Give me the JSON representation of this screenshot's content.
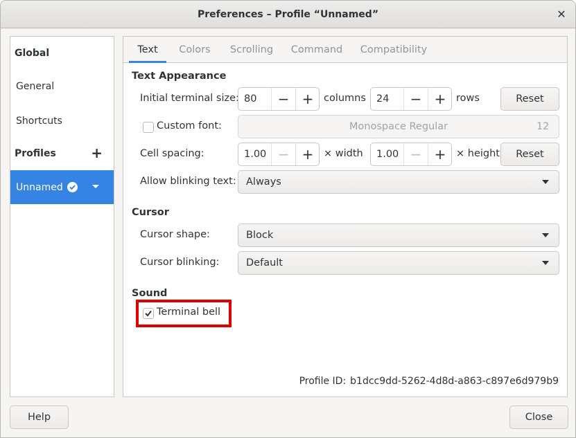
{
  "window": {
    "title": "Preferences – Profile “Unnamed”"
  },
  "sidebar": {
    "global": "Global",
    "general": "General",
    "shortcuts": "Shortcuts",
    "profiles": "Profiles",
    "profile_item": "Unnamed"
  },
  "tabs": [
    "Text",
    "Colors",
    "Scrolling",
    "Command",
    "Compatibility"
  ],
  "text_appearance": {
    "title": "Text Appearance",
    "initial_size_label": "Initial terminal size:",
    "columns_value": "80",
    "columns_unit": "columns",
    "rows_value": "24",
    "rows_unit": "rows",
    "reset": "Reset",
    "custom_font_label": "Custom font:",
    "custom_font_checked": false,
    "font_name": "Monospace Regular",
    "font_size": "12",
    "cell_spacing_label": "Cell spacing:",
    "width_value": "1.00",
    "width_unit": "× width",
    "height_value": "1.00",
    "height_unit": "× height",
    "blinking_label": "Allow blinking text:",
    "blinking_value": "Always"
  },
  "cursor": {
    "title": "Cursor",
    "shape_label": "Cursor shape:",
    "shape_value": "Block",
    "blinking_label": "Cursor blinking:",
    "blinking_value": "Default"
  },
  "sound": {
    "title": "Sound",
    "bell_label": "Terminal bell",
    "bell_checked": true
  },
  "profile_id": {
    "label": "Profile ID:",
    "value": "b1dcc9dd-5262-4d8d-a863-c897e6d979b9"
  },
  "footer": {
    "help": "Help",
    "close": "Close"
  },
  "colors": {
    "accent": "#3584e4",
    "highlight": "#e00000"
  }
}
